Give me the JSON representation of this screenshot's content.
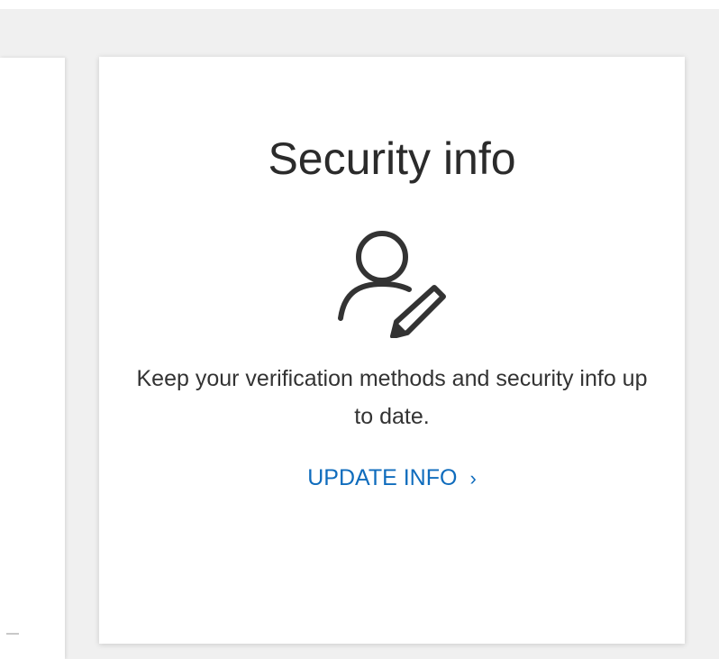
{
  "card": {
    "title": "Security info",
    "icon": "user-edit-icon",
    "description": "Keep your verification methods and security info up to date.",
    "link_label": "UPDATE INFO",
    "link_chevron": "›"
  },
  "colors": {
    "link": "#0f6cbd",
    "title": "#2b2b2b",
    "text": "#333333",
    "background": "#f0f0f0"
  }
}
